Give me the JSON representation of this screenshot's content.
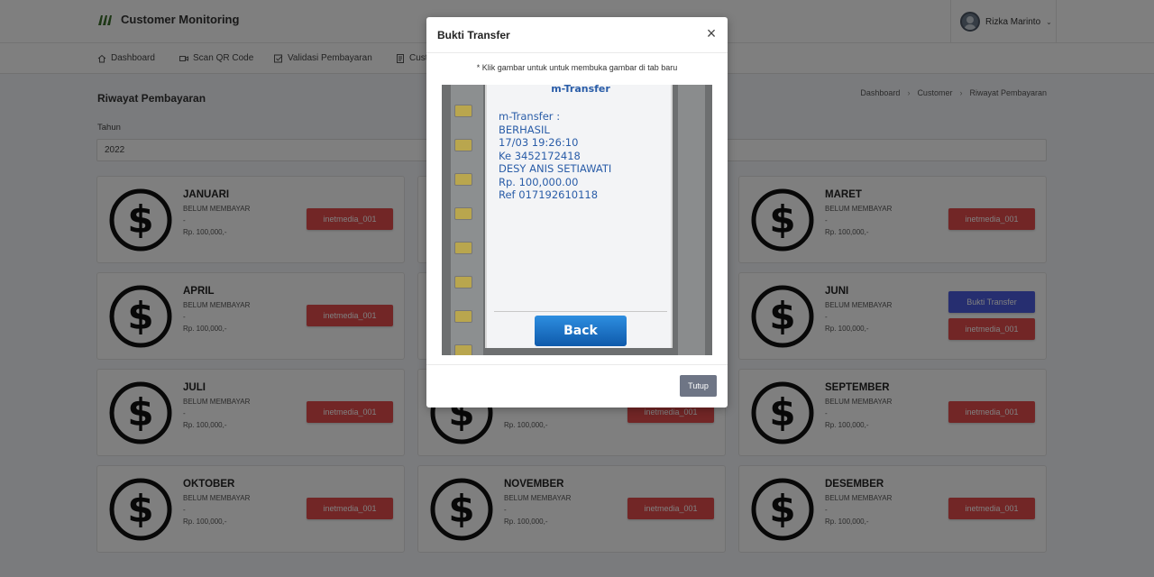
{
  "header": {
    "brand": "Customer Monitoring",
    "user_name": "Rizka Marinto",
    "caret": "⌄"
  },
  "nav": [
    {
      "label": "Dashboard",
      "icon": "home-icon"
    },
    {
      "label": "Scan QR Code",
      "icon": "video-icon"
    },
    {
      "label": "Validasi Pembayaran",
      "icon": "check-square-icon"
    },
    {
      "label": "Cust",
      "icon": "document-icon"
    }
  ],
  "page": {
    "title": "Riwayat Pembayaran",
    "breadcrumb": [
      "Dashboard",
      "Customer",
      "Riwayat Pembayaran"
    ],
    "breadcrumb_sep": "›",
    "year_label": "Tahun",
    "year_value": "2022"
  },
  "cards": [
    {
      "month": "JANUARI",
      "status": "BELUM MEMBAYAR",
      "dash": "-",
      "amount": "Rp. 100,000,-",
      "button": "inetmedia_001"
    },
    {
      "month": "MARET",
      "status": "BELUM MEMBAYAR",
      "dash": "-",
      "amount": "Rp. 100,000,-",
      "button": "inetmedia_001"
    },
    {
      "month": "APRIL",
      "status": "BELUM MEMBAYAR",
      "dash": "-",
      "amount": "Rp. 100,000,-",
      "button": "inetmedia_001"
    },
    {
      "month": "JUNI",
      "status": "BELUM MEMBAYAR",
      "dash": "-",
      "amount": "Rp. 100,000,-",
      "button": "inetmedia_001",
      "proof_button": "Bukti Transfer"
    },
    {
      "month": "JULI",
      "status": "BELUM MEMBAYAR",
      "dash": "-",
      "amount": "Rp. 100,000,-",
      "button": "inetmedia_001"
    },
    {
      "amount": "Rp. 100,000,-",
      "button": "inetmedia_001"
    },
    {
      "month": "SEPTEMBER",
      "status": "BELUM MEMBAYAR",
      "dash": "-",
      "amount": "Rp. 100,000,-",
      "button": "inetmedia_001"
    },
    {
      "month": "OKTOBER",
      "status": "BELUM MEMBAYAR",
      "dash": "-",
      "amount": "Rp. 100,000,-",
      "button": "inetmedia_001"
    },
    {
      "month": "NOVEMBER",
      "status": "BELUM MEMBAYAR",
      "dash": "-",
      "amount": "Rp. 100,000,-",
      "button": "inetmedia_001"
    },
    {
      "month": "DESEMBER",
      "status": "BELUM MEMBAYAR",
      "dash": "-",
      "amount": "Rp. 100,000,-",
      "button": "inetmedia_001"
    }
  ],
  "modal": {
    "title": "Bukti Transfer",
    "close_glyph": "×",
    "note": "* Klik gambar untuk untuk membuka gambar di tab baru",
    "proof": {
      "heading": "m-Transfer",
      "lines": [
        "m-Transfer :",
        "BERHASIL",
        "17/03 19:26:10",
        "Ke 3452172418",
        "DESY ANIS SETIAWATI",
        "Rp. 100,000.00",
        "Ref 017192610118"
      ],
      "back_label": "Back"
    },
    "close_button": "Tutup"
  },
  "colors": {
    "danger": "#e54d4d",
    "primary": "#4d5ce0",
    "secondary": "#6e7585",
    "brand_logo": "#3a6e2a",
    "proof_text": "#2a5da8"
  }
}
